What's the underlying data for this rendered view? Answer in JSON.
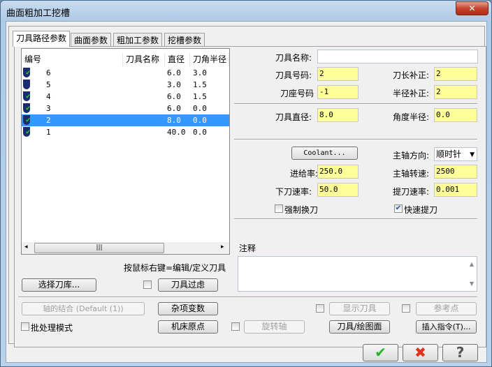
{
  "window": {
    "title": "曲面粗加工挖槽",
    "close": "✕"
  },
  "tabs": [
    "刀具路径参数",
    "曲面参数",
    "粗加工参数",
    "挖槽参数"
  ],
  "tool_list": {
    "headers": [
      "编号",
      "刀具名称",
      "直径",
      "刀角半径"
    ],
    "rows": [
      {
        "num": "6",
        "name": "",
        "dia": "6.0",
        "rad": "3.0",
        "checked": true
      },
      {
        "num": "5",
        "name": "",
        "dia": "3.0",
        "rad": "1.5",
        "checked": false
      },
      {
        "num": "4",
        "name": "",
        "dia": "6.0",
        "rad": "1.5",
        "checked": true
      },
      {
        "num": "3",
        "name": "",
        "dia": "6.0",
        "rad": "0.0",
        "checked": true
      },
      {
        "num": "2",
        "name": "",
        "dia": "8.0",
        "rad": "0.0",
        "checked": true,
        "selected": true
      },
      {
        "num": "1",
        "name": "",
        "dia": "40.0",
        "rad": "0.0",
        "checked": true
      }
    ]
  },
  "fields": {
    "tool_name_label": "刀具名称:",
    "tool_name": "",
    "tool_no_label": "刀具号码:",
    "tool_no": "2",
    "len_comp_label": "刀长补正:",
    "len_comp": "2",
    "holder_label": "刀座号码",
    "holder": "-1",
    "rad_comp_label": "半径补正:",
    "rad_comp": "2",
    "dia_label": "刀具直径:",
    "dia": "8.0",
    "corner_label": "角度半径:",
    "corner": "0.0",
    "coolant": "Coolant...",
    "spindle_dir_label": "主轴方向:",
    "spindle_dir": "顺时针",
    "feed_label": "进给率:",
    "feed": "250.0",
    "spindle_speed_label": "主轴转速:",
    "spindle_speed": "2500",
    "plunge_label": "下刀速率:",
    "plunge": "50.0",
    "retract_label": "提刀速率:",
    "retract": "0.001",
    "force_change": "强制换刀",
    "force_change_checked": false,
    "rapid_retract": "快速提刀",
    "rapid_retract_checked": true,
    "comment_label": "注释"
  },
  "hint": "按鼠标右键=编辑/定义刀具",
  "buttons": {
    "select_lib": "选择刀库...",
    "filter": "刀具过虑",
    "axis_combo": "轴的结合 (Default (1))",
    "misc": "杂项变数",
    "show_tool": "显示刀具",
    "ref_point": "参考点",
    "batch": "批处理模式",
    "home": "机床原点",
    "rotary": "旋转轴",
    "tool_plane": "刀具/绘图面",
    "insert": "插入指令(T)..."
  },
  "dialog": {
    "ok": "✔",
    "cancel": "✖",
    "help": "?"
  }
}
